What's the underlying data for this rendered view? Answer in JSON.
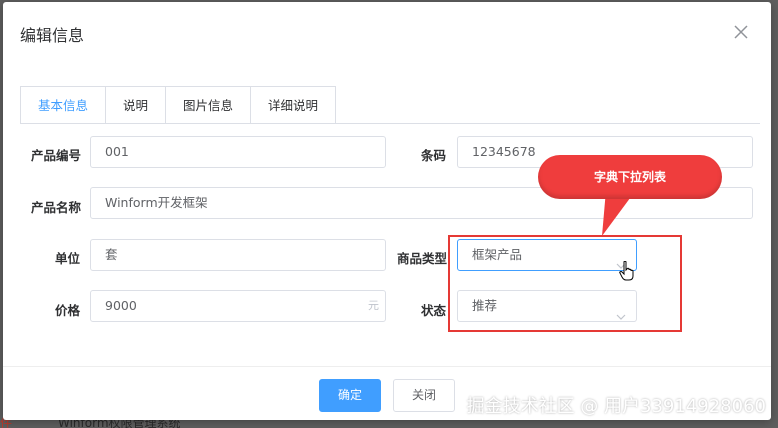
{
  "background": {
    "left_fragment": "件",
    "row_text": "Winform权限管理系统"
  },
  "dialog": {
    "title": "编辑信息",
    "close_icon": "close-icon"
  },
  "tabs": [
    {
      "label": "基本信息",
      "active": true
    },
    {
      "label": "说明",
      "active": false
    },
    {
      "label": "图片信息",
      "active": false
    },
    {
      "label": "详细说明",
      "active": false
    }
  ],
  "form": {
    "product_code": {
      "label": "产品编号",
      "value": "001"
    },
    "barcode": {
      "label": "条码",
      "value": "12345678"
    },
    "product_name": {
      "label": "产品名称",
      "value": "Winform开发框架"
    },
    "unit": {
      "label": "单位",
      "value": "套"
    },
    "product_type": {
      "label": "商品类型",
      "value": "框架产品"
    },
    "price": {
      "label": "价格",
      "value": "9000",
      "suffix": "元"
    },
    "status": {
      "label": "状态",
      "value": "推荐"
    }
  },
  "annotation": {
    "callout_text": "字典下拉列表",
    "color": "#ef3d3d"
  },
  "footer": {
    "confirm_label": "确定",
    "close_label": "关闭"
  },
  "watermark": "掘金技术社区 @ 用户33914928060",
  "colors": {
    "primary": "#409eff",
    "border": "#dcdfe6",
    "annotation_red": "#e53935"
  }
}
